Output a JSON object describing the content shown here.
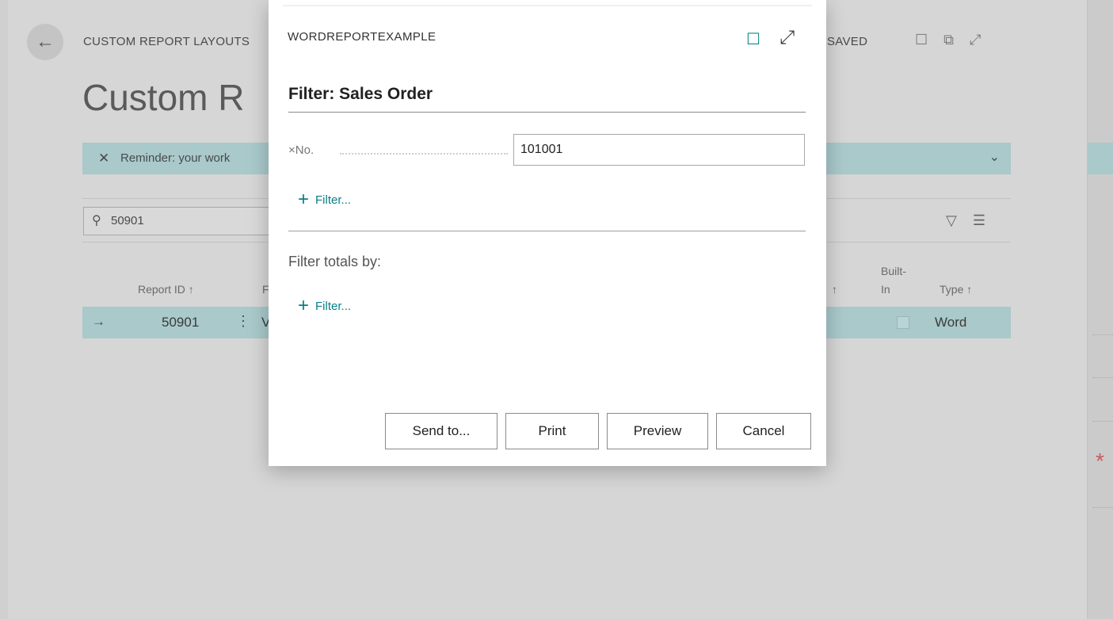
{
  "background": {
    "breadcrumb": "CUSTOM REPORT LAYOUTS",
    "saved_label": "SAVED",
    "page_title": "Custom R",
    "banner_text": "Reminder: your work",
    "search_value": "50901",
    "columns": {
      "report_id": "Report ID ↑",
      "col_f": "F",
      "col_arrow": "↑",
      "built_in_1": "Built-",
      "built_in_2": "In",
      "type": "Type ↑"
    },
    "row": {
      "report_id": "50901",
      "name_start": "V",
      "type": "Word"
    }
  },
  "dialog": {
    "title": "WORDREPORTEXAMPLE",
    "heading": "Filter: Sales Order",
    "field_remove": "×",
    "field_label": "No.",
    "field_value": "101001",
    "add_filter_label": "Filter...",
    "totals_label": "Filter totals by:",
    "totals_add_filter_label": "Filter...",
    "buttons": {
      "send_to": "Send to...",
      "print": "Print",
      "preview": "Preview",
      "cancel": "Cancel"
    }
  },
  "colors": {
    "accent": "#0a7f86",
    "banner": "#a9c9cb",
    "overlay": "#d6d6d6"
  }
}
